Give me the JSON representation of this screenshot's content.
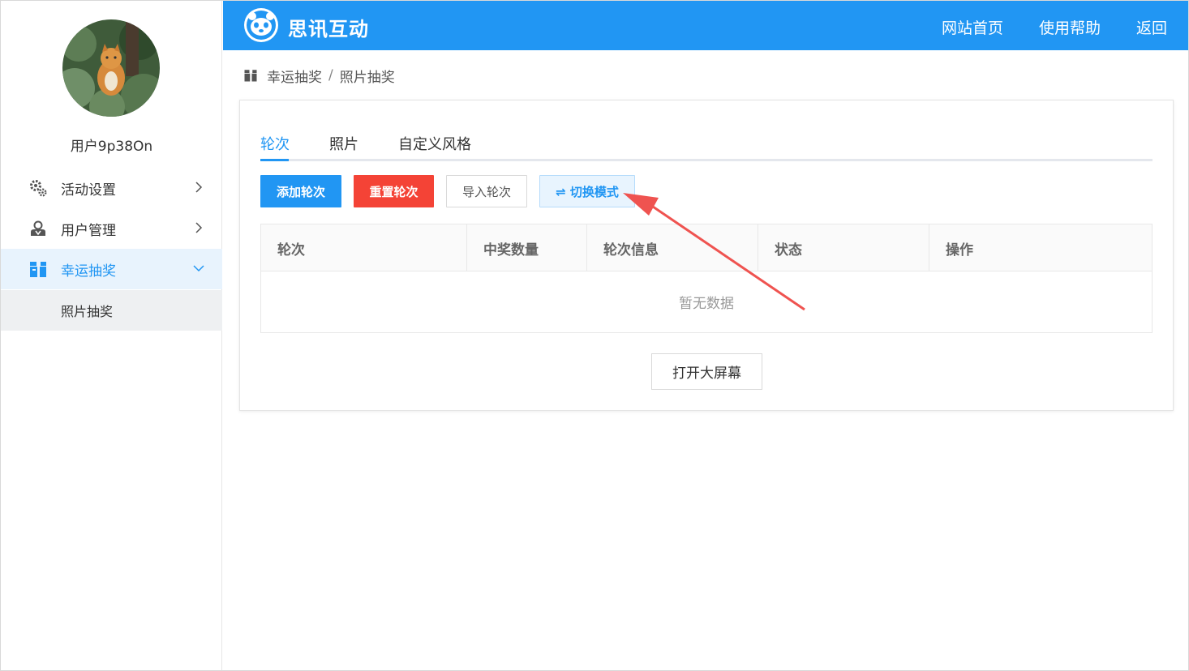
{
  "header": {
    "brand": "思讯互动",
    "nav": [
      "网站首页",
      "使用帮助",
      "返回"
    ],
    "color": "#2196f3"
  },
  "sidebar": {
    "username": "用户9p38On",
    "items": [
      {
        "label": "活动设置",
        "icon": "gears-icon"
      },
      {
        "label": "用户管理",
        "icon": "user-icon"
      },
      {
        "label": "幸运抽奖",
        "icon": "gift-icon"
      }
    ],
    "subitems": [
      {
        "label": "照片抽奖"
      }
    ]
  },
  "breadcrumb": {
    "items": [
      "幸运抽奖",
      "照片抽奖"
    ],
    "separator": "/"
  },
  "tabs": [
    {
      "label": "轮次"
    },
    {
      "label": "照片"
    },
    {
      "label": "自定义风格"
    }
  ],
  "toolbar": {
    "add_round": "添加轮次",
    "reset_round": "重置轮次",
    "import_round": "导入轮次",
    "switch_mode": "⇌ 切换模式"
  },
  "table": {
    "columns": [
      "轮次",
      "中奖数量",
      "轮次信息",
      "状态",
      "操作"
    ],
    "empty_text": "暂无数据"
  },
  "open_screen_button": "打开大屏幕",
  "colors": {
    "primary": "#2196f3",
    "danger": "#f44336",
    "annotation_arrow": "#ef5350"
  }
}
